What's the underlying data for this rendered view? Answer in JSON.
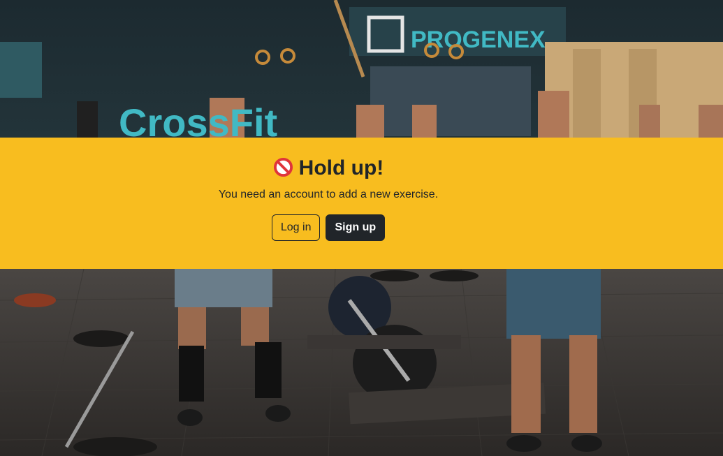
{
  "background": {
    "description_icon": "gym-photo",
    "signage": {
      "brand_left": "CrossFit",
      "brand_right": "PROGENEX"
    }
  },
  "banner": {
    "icon": "no-entry-icon",
    "title": "Hold up!",
    "message": "You need an account to add a new exercise.",
    "login_label": "Log in",
    "signup_label": "Sign up"
  },
  "colors": {
    "banner_bg": "#f8bd1f",
    "text": "#212529",
    "button_dark": "#212529",
    "no_entry_red": "#e0343a"
  }
}
